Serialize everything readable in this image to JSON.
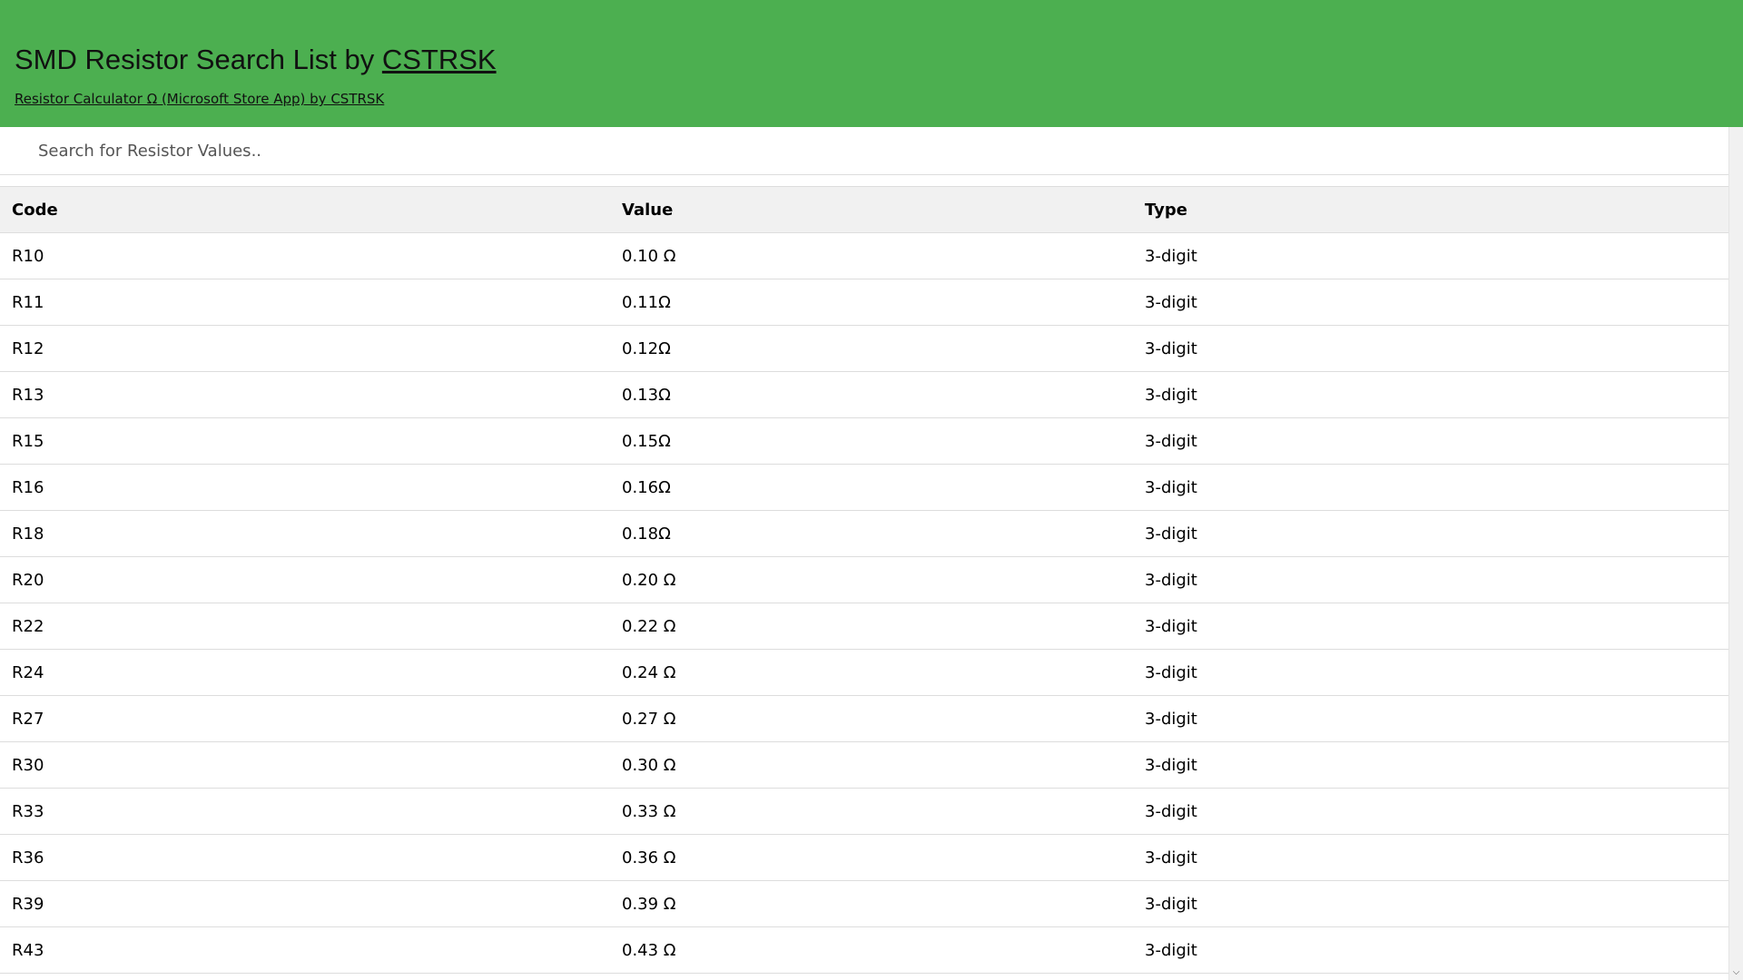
{
  "header": {
    "title_prefix": "SMD Resistor Search List by ",
    "title_link": "CSTRSK",
    "subtitle_link": "Resistor Calculator Ω (Microsoft Store App) by CSTRSK",
    "background_color": "#4caf50"
  },
  "search": {
    "value": "",
    "placeholder": "Search for Resistor Values.."
  },
  "table": {
    "headers": [
      "Code",
      "Value",
      "Type"
    ],
    "rows": [
      [
        "R10",
        "0.10 Ω",
        "3-digit"
      ],
      [
        "R11",
        "0.11Ω",
        "3-digit"
      ],
      [
        "R12",
        "0.12Ω",
        "3-digit"
      ],
      [
        "R13",
        "0.13Ω",
        "3-digit"
      ],
      [
        "R15",
        "0.15Ω",
        "3-digit"
      ],
      [
        "R16",
        "0.16Ω",
        "3-digit"
      ],
      [
        "R18",
        "0.18Ω",
        "3-digit"
      ],
      [
        "R20",
        "0.20 Ω",
        "3-digit"
      ],
      [
        "R22",
        "0.22 Ω",
        "3-digit"
      ],
      [
        "R24",
        "0.24 Ω",
        "3-digit"
      ],
      [
        "R27",
        "0.27 Ω",
        "3-digit"
      ],
      [
        "R30",
        "0.30 Ω",
        "3-digit"
      ],
      [
        "R33",
        "0.33 Ω",
        "3-digit"
      ],
      [
        "R36",
        "0.36 Ω",
        "3-digit"
      ],
      [
        "R39",
        "0.39 Ω",
        "3-digit"
      ],
      [
        "R43",
        "0.43 Ω",
        "3-digit"
      ]
    ]
  },
  "scrollbar": {
    "down_arrow_icon": "chevron-down-icon"
  }
}
